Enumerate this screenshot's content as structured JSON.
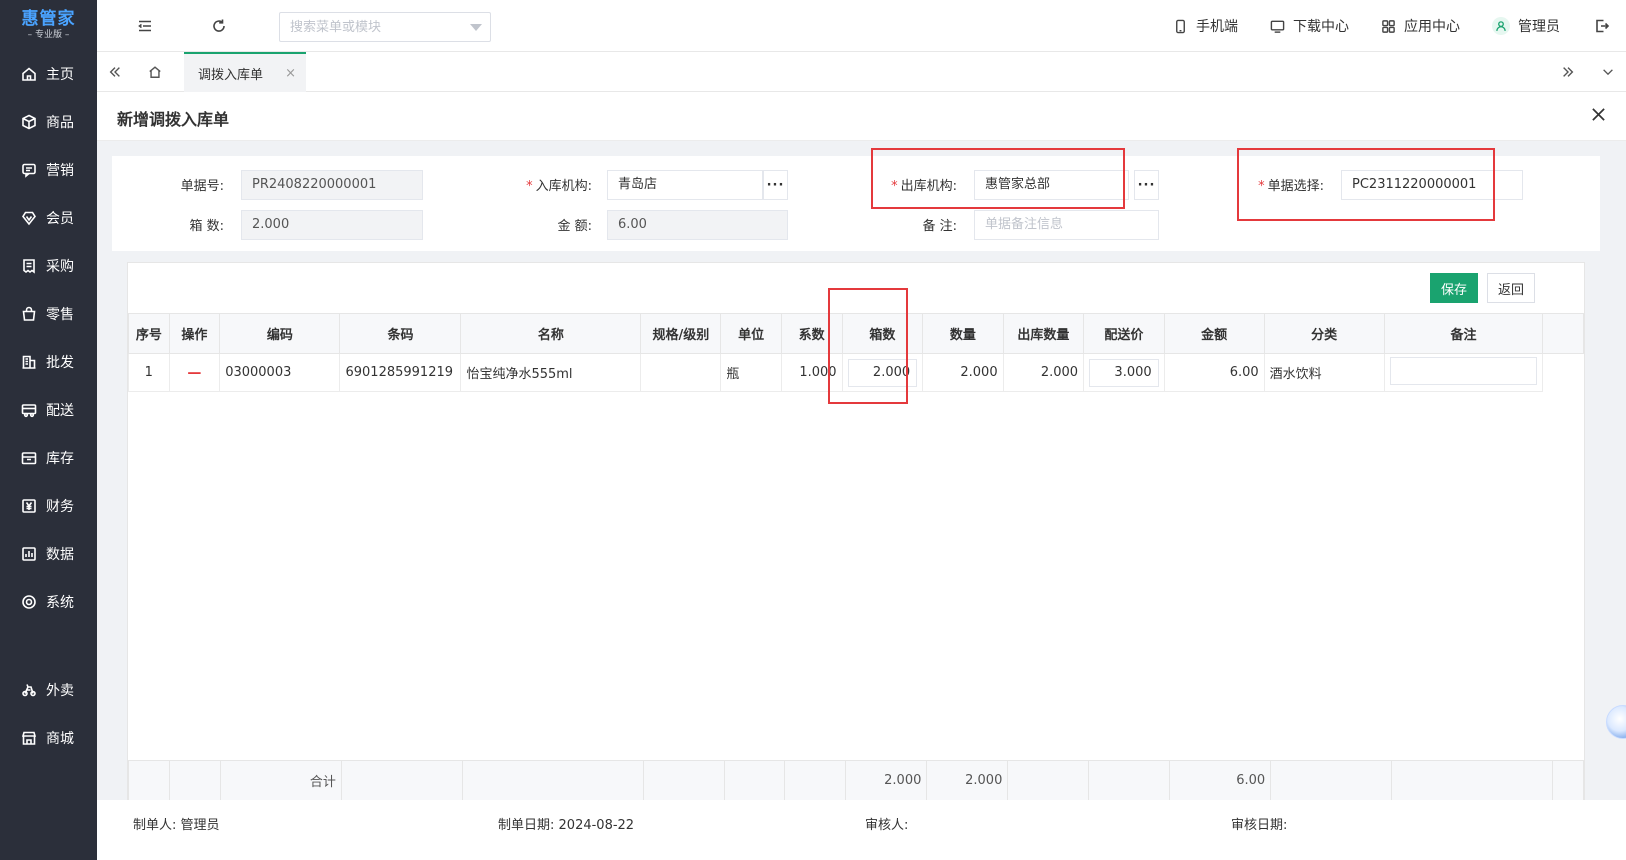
{
  "logo": {
    "brand": "惠管家",
    "edition": "– 专业版 –"
  },
  "sidebar": {
    "items": [
      {
        "label": "主页",
        "icon": "home-icon"
      },
      {
        "label": "商品",
        "icon": "box-icon"
      },
      {
        "label": "营销",
        "icon": "chat-icon"
      },
      {
        "label": "会员",
        "icon": "diamond-icon"
      },
      {
        "label": "采购",
        "icon": "receipt-icon"
      },
      {
        "label": "零售",
        "icon": "bag-icon"
      },
      {
        "label": "批发",
        "icon": "building-icon"
      },
      {
        "label": "配送",
        "icon": "truck-icon"
      },
      {
        "label": "库存",
        "icon": "archive-icon"
      },
      {
        "label": "财务",
        "icon": "yen-icon"
      },
      {
        "label": "数据",
        "icon": "chart-icon"
      },
      {
        "label": "系统",
        "icon": "settings-icon"
      },
      {
        "label": "外卖",
        "icon": "scooter-icon"
      },
      {
        "label": "商城",
        "icon": "store-icon"
      }
    ]
  },
  "topbar": {
    "search_placeholder": "搜索菜单或模块",
    "links": {
      "mobile": "手机端",
      "download": "下载中心",
      "apps": "应用中心",
      "user": "管理员"
    }
  },
  "tabs": {
    "active": "调拨入库单",
    "close": "×"
  },
  "page": {
    "title": "新增调拨入库单"
  },
  "form": {
    "doc_no_label": "单据号:",
    "doc_no": "PR2408220000001",
    "inbound_org_label": "入库机构:",
    "inbound_org": "青岛店",
    "outbound_org_label": "出库机构:",
    "outbound_org": "惠管家总部",
    "doc_select_label": "单据选择:",
    "doc_select": "PC2311220000001",
    "boxes_label": "箱 数:",
    "boxes": "2.000",
    "amount_label": "金 额:",
    "amount": "6.00",
    "remark_label": "备 注:",
    "remark_placeholder": "单据备注信息",
    "required_mark": "*",
    "dots": "···"
  },
  "actions": {
    "save": "保存",
    "back": "返回"
  },
  "table": {
    "headers": [
      "序号",
      "操作",
      "编码",
      "条码",
      "名称",
      "规格/级别",
      "单位",
      "系数",
      "箱数",
      "数量",
      "出库数量",
      "配送价",
      "金额",
      "分类",
      "备注"
    ],
    "rows": [
      {
        "index": "1",
        "op": "—",
        "code": "03000003",
        "barcode": "6901285991219",
        "name": "怡宝纯净水555ml",
        "spec": "",
        "unit": "瓶",
        "factor": "1.000",
        "boxes": "2.000",
        "qty": "2.000",
        "out_qty": "2.000",
        "price": "3.000",
        "amount": "6.00",
        "category": "酒水饮料",
        "remark": ""
      }
    ],
    "footer": {
      "label": "合计",
      "boxes": "2.000",
      "qty": "2.000",
      "amount": "6.00"
    }
  },
  "footer_info": {
    "creator_label": "制单人:",
    "creator": "管理员",
    "created_date_label": "制单日期:",
    "created_date": "2024-08-22",
    "reviewer_label": "审核人:",
    "reviewer": "",
    "review_date_label": "审核日期:",
    "review_date": ""
  },
  "colors": {
    "primary": "#1aa36f",
    "sidebar_bg": "#2b2f3a",
    "highlight_box": "#e4393c",
    "brand": "#4aa3ff"
  }
}
